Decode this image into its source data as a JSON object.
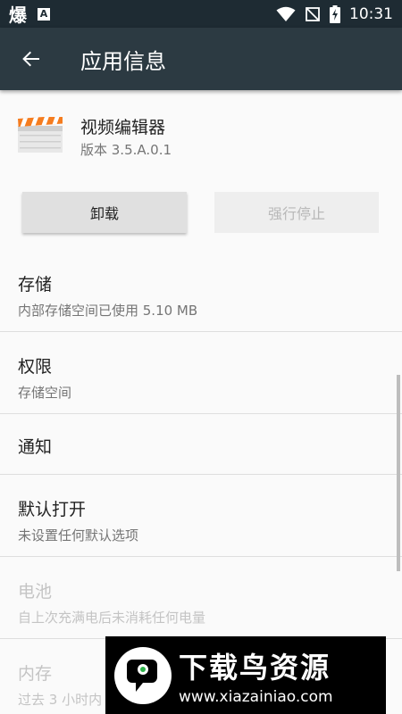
{
  "status_bar": {
    "left_glyph": "爆",
    "time": "10:31"
  },
  "app_bar": {
    "title": "应用信息"
  },
  "app": {
    "name": "视频编辑器",
    "version": "版本 3.5.A.0.1"
  },
  "buttons": {
    "uninstall": "卸载",
    "force_stop": "强行停止"
  },
  "items": [
    {
      "title": "存储",
      "subtitle": "内部存储空间已使用 5.10 MB"
    },
    {
      "title": "权限",
      "subtitle": "存储空间"
    },
    {
      "title": "通知",
      "subtitle": ""
    },
    {
      "title": "默认打开",
      "subtitle": "未设置任何默认选项"
    },
    {
      "title": "电池",
      "subtitle": "自上次充满电后未消耗任何电量"
    },
    {
      "title": "内存",
      "subtitle": "过去 3 小时内"
    }
  ],
  "watermark": {
    "title": "下载鸟资源",
    "url": "www.xiazainiao.com"
  },
  "colors": {
    "status_bar": "#1e2b33",
    "app_bar": "#2c3a42",
    "icon_orange": "#f57c1f"
  }
}
